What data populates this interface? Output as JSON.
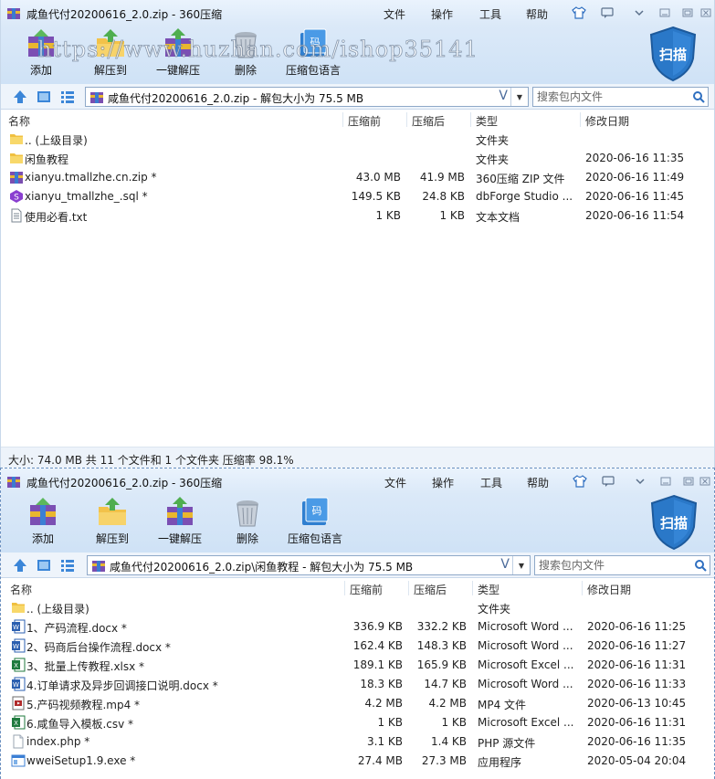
{
  "windows": [
    {
      "title": "咸鱼代付20200616_2.0.zip - 360压缩",
      "menu": [
        "文件",
        "操作",
        "工具",
        "帮助"
      ],
      "tools": [
        "添加",
        "解压到",
        "一键解压",
        "删除",
        "压缩包语言"
      ],
      "scan": "扫描",
      "address": "咸鱼代付20200616_2.0.zip - 解包大小为 75.5 MB",
      "search_placeholder": "搜索包内文件",
      "columns": [
        "名称",
        "压缩前",
        "压缩后",
        "类型",
        "修改日期"
      ],
      "rows": [
        {
          "name": ".. (上级目录)",
          "before": "",
          "after": "",
          "type": "文件夹",
          "date": "",
          "icon": "folder-icon"
        },
        {
          "name": "闲鱼教程",
          "before": "",
          "after": "",
          "type": "文件夹",
          "date": "2020-06-16 11:35",
          "icon": "folder-icon"
        },
        {
          "name": "xianyu.tmallzhe.cn.zip *",
          "before": "43.0 MB",
          "after": "41.9 MB",
          "type": "360压缩 ZIP 文件",
          "date": "2020-06-16 11:49",
          "icon": "zip-icon"
        },
        {
          "name": "xianyu_tmallzhe_.sql *",
          "before": "149.5 KB",
          "after": "24.8 KB",
          "type": "dbForge Studio ...",
          "date": "2020-06-16 11:45",
          "icon": "sql-icon"
        },
        {
          "name": "使用必看.txt",
          "before": "1 KB",
          "after": "1 KB",
          "type": "文本文档",
          "date": "2020-06-16 11:54",
          "icon": "txt-icon"
        }
      ],
      "status": "大小: 74.0 MB 共 11 个文件和 1 个文件夹 压缩率 98.1%",
      "watermark": "https://www.huzhan.com/ishop35141"
    },
    {
      "title": "咸鱼代付20200616_2.0.zip - 360压缩",
      "menu": [
        "文件",
        "操作",
        "工具",
        "帮助"
      ],
      "tools": [
        "添加",
        "解压到",
        "一键解压",
        "删除",
        "压缩包语言"
      ],
      "scan": "扫描",
      "address": "咸鱼代付20200616_2.0.zip\\闲鱼教程 - 解包大小为 75.5 MB",
      "search_placeholder": "搜索包内文件",
      "columns": [
        "名称",
        "压缩前",
        "压缩后",
        "类型",
        "修改日期"
      ],
      "rows": [
        {
          "name": ".. (上级目录)",
          "before": "",
          "after": "",
          "type": "文件夹",
          "date": "",
          "icon": "folder-icon"
        },
        {
          "name": "1、产码流程.docx *",
          "before": "336.9 KB",
          "after": "332.2 KB",
          "type": "Microsoft Word ...",
          "date": "2020-06-16 11:25",
          "icon": "word-icon"
        },
        {
          "name": "2、码商后台操作流程.docx *",
          "before": "162.4 KB",
          "after": "148.3 KB",
          "type": "Microsoft Word ...",
          "date": "2020-06-16 11:27",
          "icon": "word-icon"
        },
        {
          "name": "3、批量上传教程.xlsx *",
          "before": "189.1 KB",
          "after": "165.9 KB",
          "type": "Microsoft Excel ...",
          "date": "2020-06-16 11:31",
          "icon": "excel-icon"
        },
        {
          "name": "4.订单请求及异步回调接口说明.docx *",
          "before": "18.3 KB",
          "after": "14.7 KB",
          "type": "Microsoft Word ...",
          "date": "2020-06-16 11:33",
          "icon": "word-icon"
        },
        {
          "name": "5.产码视频教程.mp4 *",
          "before": "4.2 MB",
          "after": "4.2 MB",
          "type": "MP4 文件",
          "date": "2020-06-13 10:45",
          "icon": "video-icon"
        },
        {
          "name": "6.咸鱼导入模板.csv *",
          "before": "1 KB",
          "after": "1 KB",
          "type": "Microsoft Excel ...",
          "date": "2020-06-16 11:31",
          "icon": "excel-icon"
        },
        {
          "name": "index.php *",
          "before": "3.1 KB",
          "after": "1.4 KB",
          "type": "PHP 源文件",
          "date": "2020-06-16 11:35",
          "icon": "php-icon"
        },
        {
          "name": "wweiSetup1.9.exe *",
          "before": "27.4 MB",
          "after": "27.3 MB",
          "type": "应用程序",
          "date": "2020-05-04 20:04",
          "icon": "exe-icon"
        }
      ]
    }
  ],
  "colors": {
    "titlebar": "#e3eefb",
    "ribbon": "#d4e5f7",
    "accent": "#2f6fc0",
    "shield": "#2a78c8"
  }
}
